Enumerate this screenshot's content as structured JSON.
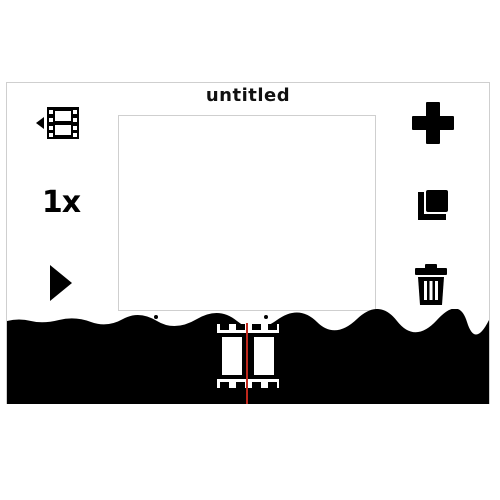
{
  "document": {
    "title": "untitled"
  },
  "left_toolbar": {
    "frames_icon": "film-frames-icon",
    "speed_label": "1x",
    "play_icon": "play-icon"
  },
  "right_toolbar": {
    "add_icon": "plus-icon",
    "duplicate_icon": "duplicate-frame-icon",
    "delete_icon": "trash-icon"
  },
  "timeline": {
    "frames": [
      {
        "icon": "film-frame-thumbnail"
      }
    ],
    "playhead_color": "#c0281c"
  },
  "colors": {
    "ink": "#000000",
    "paper": "#ffffff",
    "frame_border": "#cfcfcf"
  }
}
